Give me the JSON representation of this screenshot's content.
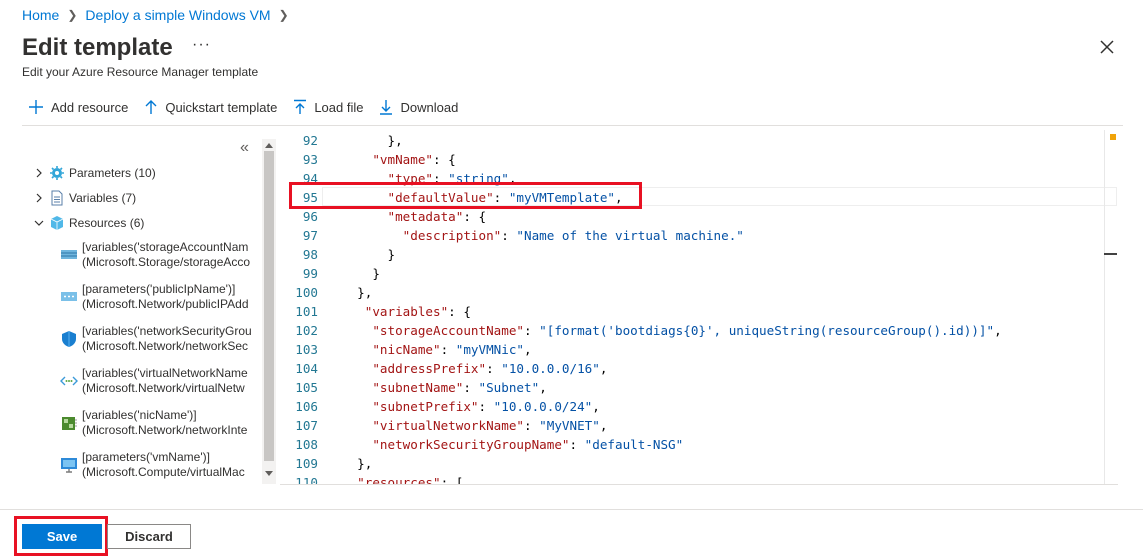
{
  "breadcrumb": {
    "home": "Home",
    "page": "Deploy a simple Windows VM"
  },
  "header": {
    "title": "Edit template",
    "more": "···",
    "subtitle": "Edit your Azure Resource Manager template"
  },
  "toolbar": {
    "add_resource": "Add resource",
    "quickstart": "Quickstart template",
    "load_file": "Load file",
    "download": "Download"
  },
  "tree": {
    "collapse": "«",
    "parameters": "Parameters (10)",
    "variables": "Variables (7)",
    "resources": "Resources (6)",
    "items": [
      {
        "line1": "[variables('storageAccountNam",
        "line2": "(Microsoft.Storage/storageAcco",
        "icon": "storage-icon"
      },
      {
        "line1": "[parameters('publicIpName')]",
        "line2": "(Microsoft.Network/publicIPAdd",
        "icon": "public-ip-icon"
      },
      {
        "line1": "[variables('networkSecurityGrou",
        "line2": "(Microsoft.Network/networkSec",
        "icon": "shield-icon"
      },
      {
        "line1": "[variables('virtualNetworkName",
        "line2": "(Microsoft.Network/virtualNetw",
        "icon": "vnet-icon"
      },
      {
        "line1": "[variables('nicName')]",
        "line2": "(Microsoft.Network/networkInte",
        "icon": "nic-icon"
      },
      {
        "line1": "[parameters('vmName')]",
        "line2": "(Microsoft.Compute/virtualMac",
        "icon": "vm-icon"
      }
    ]
  },
  "editor": {
    "lines": [
      {
        "n": "92",
        "indent": "      ",
        "parts": [
          [
            "p",
            "},"
          ]
        ]
      },
      {
        "n": "93",
        "indent": "    ",
        "parts": [
          [
            "k",
            "\"vmName\""
          ],
          [
            "p",
            ": {"
          ]
        ]
      },
      {
        "n": "94",
        "indent": "      ",
        "parts": [
          [
            "k",
            "\"type\""
          ],
          [
            "p",
            ": "
          ],
          [
            "s",
            "\"string\""
          ],
          [
            "p",
            ","
          ]
        ]
      },
      {
        "n": "95",
        "indent": "      ",
        "parts": [
          [
            "k",
            "\"defaultValue\""
          ],
          [
            "p",
            ": "
          ],
          [
            "s",
            "\"myVMTemplate\""
          ],
          [
            "p",
            ","
          ]
        ]
      },
      {
        "n": "96",
        "indent": "      ",
        "parts": [
          [
            "k",
            "\"metadata\""
          ],
          [
            "p",
            ": {"
          ]
        ]
      },
      {
        "n": "97",
        "indent": "        ",
        "parts": [
          [
            "k",
            "\"description\""
          ],
          [
            "p",
            ": "
          ],
          [
            "s",
            "\"Name of the virtual machine.\""
          ]
        ]
      },
      {
        "n": "98",
        "indent": "      ",
        "parts": [
          [
            "p",
            "}"
          ]
        ]
      },
      {
        "n": "99",
        "indent": "    ",
        "parts": [
          [
            "p",
            "}"
          ]
        ]
      },
      {
        "n": "100",
        "indent": "  ",
        "parts": [
          [
            "p",
            "},"
          ]
        ]
      },
      {
        "n": "101",
        "indent": "   ",
        "parts": [
          [
            "k",
            "\"variables\""
          ],
          [
            "p",
            ": {"
          ]
        ]
      },
      {
        "n": "102",
        "indent": "    ",
        "parts": [
          [
            "k",
            "\"storageAccountName\""
          ],
          [
            "p",
            ": "
          ],
          [
            "s",
            "\"[format('bootdiags{0}', uniqueString(resourceGroup().id))]\""
          ],
          [
            "p",
            ","
          ]
        ]
      },
      {
        "n": "103",
        "indent": "    ",
        "parts": [
          [
            "k",
            "\"nicName\""
          ],
          [
            "p",
            ": "
          ],
          [
            "s",
            "\"myVMNic\""
          ],
          [
            "p",
            ","
          ]
        ]
      },
      {
        "n": "104",
        "indent": "    ",
        "parts": [
          [
            "k",
            "\"addressPrefix\""
          ],
          [
            "p",
            ": "
          ],
          [
            "s",
            "\"10.0.0.0/16\""
          ],
          [
            "p",
            ","
          ]
        ]
      },
      {
        "n": "105",
        "indent": "    ",
        "parts": [
          [
            "k",
            "\"subnetName\""
          ],
          [
            "p",
            ": "
          ],
          [
            "s",
            "\"Subnet\""
          ],
          [
            "p",
            ","
          ]
        ]
      },
      {
        "n": "106",
        "indent": "    ",
        "parts": [
          [
            "k",
            "\"subnetPrefix\""
          ],
          [
            "p",
            ": "
          ],
          [
            "s",
            "\"10.0.0.0/24\""
          ],
          [
            "p",
            ","
          ]
        ]
      },
      {
        "n": "107",
        "indent": "    ",
        "parts": [
          [
            "k",
            "\"virtualNetworkName\""
          ],
          [
            "p",
            ": "
          ],
          [
            "s",
            "\"MyVNET\""
          ],
          [
            "p",
            ","
          ]
        ]
      },
      {
        "n": "108",
        "indent": "    ",
        "parts": [
          [
            "k",
            "\"networkSecurityGroupName\""
          ],
          [
            "p",
            ": "
          ],
          [
            "s",
            "\"default-NSG\""
          ]
        ]
      },
      {
        "n": "109",
        "indent": "  ",
        "parts": [
          [
            "p",
            "},"
          ]
        ]
      },
      {
        "n": "110",
        "indent": "  ",
        "parts": [
          [
            "k",
            "\"resources\""
          ],
          [
            "p",
            ": ["
          ]
        ]
      }
    ]
  },
  "footer": {
    "save": "Save",
    "discard": "Discard"
  },
  "colors": {
    "accent": "#0078d4",
    "highlight": "#e81123",
    "json_key": "#a31515",
    "json_string": "#0451a5"
  }
}
